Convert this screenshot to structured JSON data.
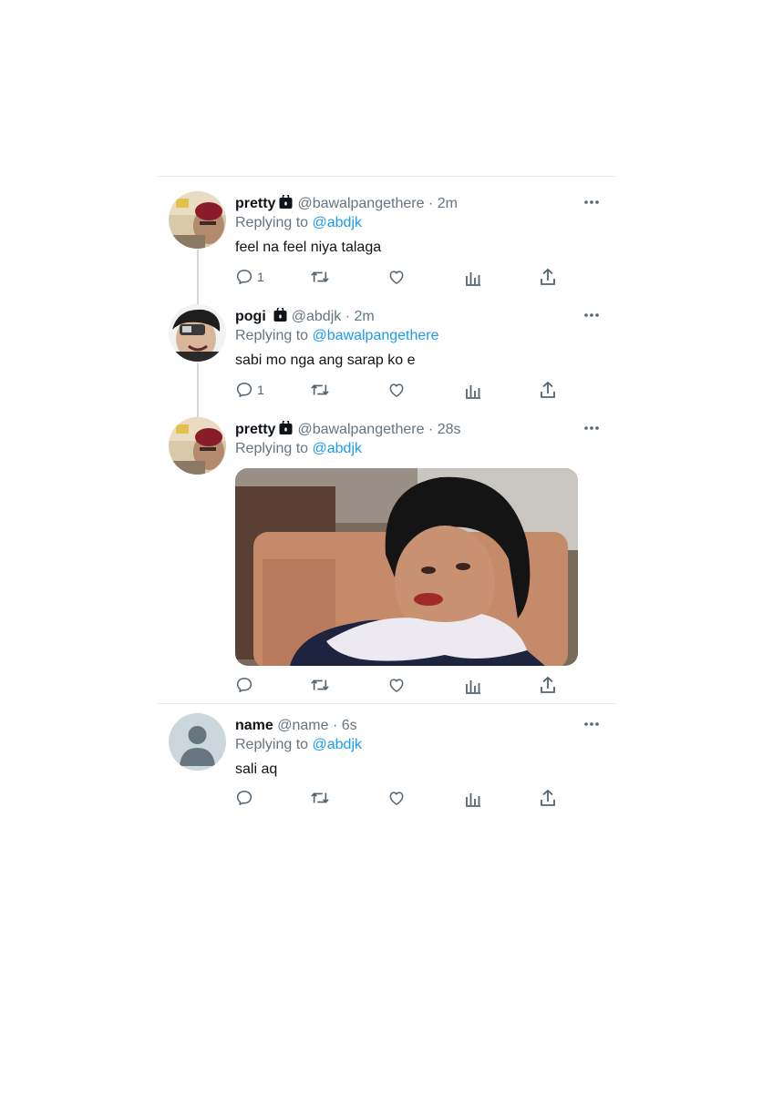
{
  "tweets": [
    {
      "name": "pretty",
      "handle": "@bawalpangethere",
      "dot": "·",
      "time": "2m",
      "replying_label": "Replying to",
      "replying_to": "@abdjk",
      "text": "feel na feel niya talaga",
      "reply_count": "1"
    },
    {
      "name": "pogi",
      "handle": "@abdjk",
      "dot": "·",
      "time": "2m",
      "replying_label": "Replying to",
      "replying_to": "@bawalpangethere",
      "text": "sabi mo nga ang sarap ko e",
      "reply_count": "1"
    },
    {
      "name": "pretty",
      "handle": "@bawalpangethere",
      "dot": "·",
      "time": "28s",
      "replying_label": "Replying to",
      "replying_to": "@abdjk",
      "media": "reaction-meme-image"
    },
    {
      "name": "name",
      "handle": "@name",
      "dot": "·",
      "time": "6s",
      "replying_label": "Replying to",
      "replying_to": "@abdjk",
      "text": "sali aq"
    }
  ],
  "icons": [
    "lock-icon",
    "more-icon",
    "reply-icon",
    "retweet-icon",
    "like-icon",
    "analytics-icon",
    "share-icon",
    "default-avatar-icon"
  ],
  "colors": {
    "accent": "#1d9bf0",
    "secondary_text": "#66757f",
    "divider": "#e6ecf0"
  }
}
